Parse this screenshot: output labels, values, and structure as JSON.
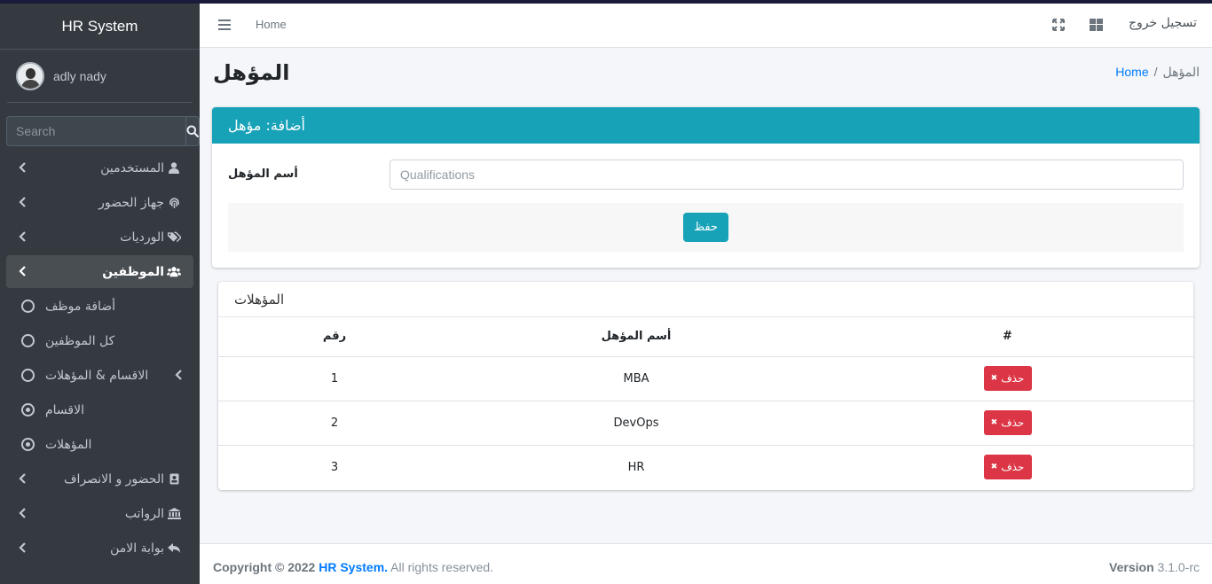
{
  "brand": "HR System",
  "user": {
    "name": "adly nady"
  },
  "search": {
    "placeholder": "Search"
  },
  "nav": {
    "users": "المستخدمين",
    "attendance_device": "جهاز الحضور",
    "shifts": "الورديات",
    "employees": "الموظفين",
    "add_employee": "أضافة موظف",
    "all_employees": "كل الموظفين",
    "departments_qualifications": "الاقسام & المؤهلات",
    "departments": "الاقسام",
    "qualifications": "المؤهلات",
    "attendance_leave": "الحضور و الانصراف",
    "salaries": "الرواتب",
    "security_gate": "بوابة الامن"
  },
  "header": {
    "home": "Home",
    "logout": "تسجيل خروج"
  },
  "page": {
    "title": "المؤهل"
  },
  "breadcrumb": {
    "home": "Home",
    "separator": "/",
    "current": "المؤهل"
  },
  "add_form": {
    "title": "أضافة: مؤهل",
    "label": "أسم المؤهل",
    "placeholder": "Qualifications",
    "save": "حفظ"
  },
  "table": {
    "title": "المؤهلات",
    "headers": {
      "num": "رقم",
      "name": "أسم المؤهل",
      "action": "#"
    },
    "rows": [
      {
        "num": "1",
        "name": "MBA",
        "delete": "حذف"
      },
      {
        "num": "2",
        "name": "DevOps",
        "delete": "حذف"
      },
      {
        "num": "3",
        "name": "HR",
        "delete": "حذف"
      }
    ]
  },
  "footer": {
    "copyright": "Copyright © 2022",
    "system": "HR System.",
    "rights": "All rights reserved.",
    "version_label": "Version",
    "version": "3.1.0-rc"
  },
  "colors": {
    "sidebar": "#343a40",
    "accent": "#17a2b8",
    "danger": "#dc3545",
    "link": "#007bff"
  }
}
